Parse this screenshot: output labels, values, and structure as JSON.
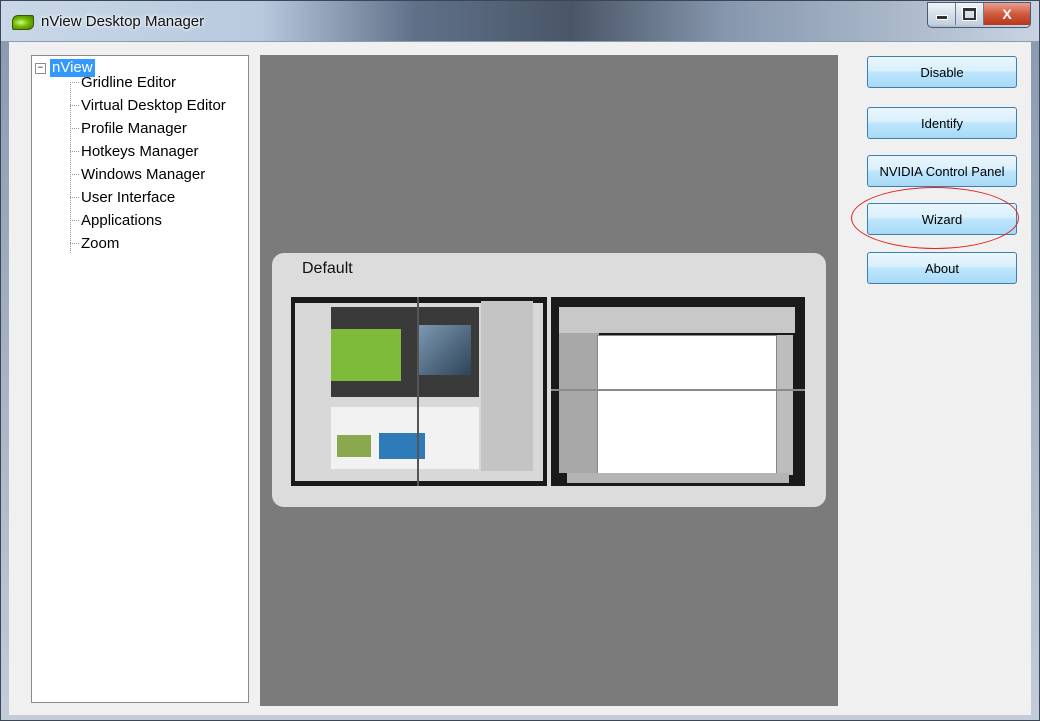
{
  "window": {
    "title": "nView Desktop Manager"
  },
  "titlebar": {
    "close_glyph": "X"
  },
  "tree": {
    "root": {
      "label": "nView",
      "expander": "−"
    },
    "children": [
      {
        "label": "Gridline Editor"
      },
      {
        "label": "Virtual Desktop Editor"
      },
      {
        "label": "Profile Manager"
      },
      {
        "label": "Hotkeys Manager"
      },
      {
        "label": "Windows Manager"
      },
      {
        "label": "User Interface"
      },
      {
        "label": "Applications"
      },
      {
        "label": "Zoom"
      }
    ]
  },
  "profile": {
    "name": "Default"
  },
  "buttons": {
    "disable": "Disable",
    "identify": "Identify",
    "nvidia_control_panel": "NVIDIA Control Panel",
    "wizard": "Wizard",
    "about": "About"
  },
  "colors": {
    "tree_selection": "#3399ff",
    "desktop_area": "#7b7b7b",
    "annotation": "#dd2222",
    "nvidia_green": "#76b900"
  }
}
